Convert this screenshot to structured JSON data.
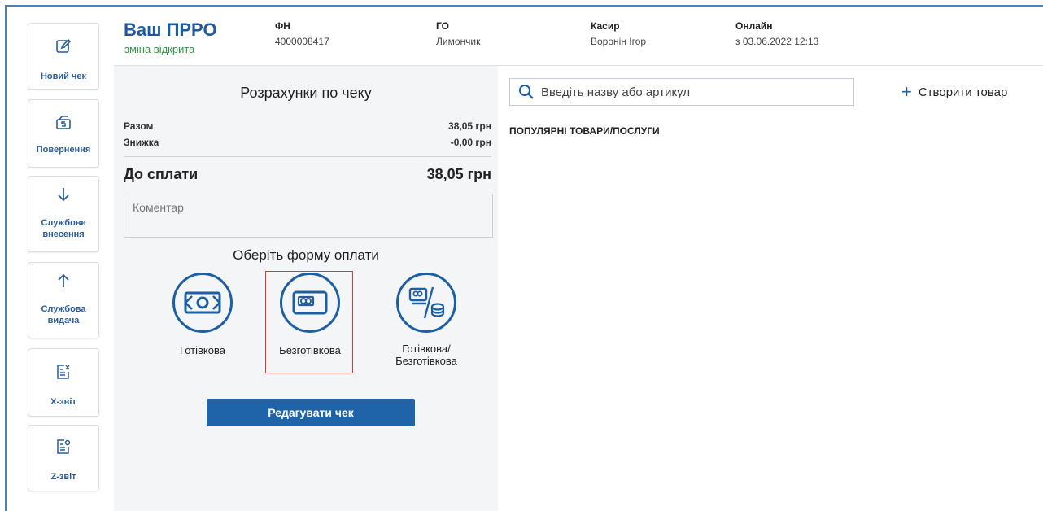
{
  "header": {
    "title": "Ваш ПРРО",
    "status": "зміна відкрита",
    "fn_label": "ФН",
    "fn_value": "4000008417",
    "go_label": "ГО",
    "go_value": "Лимончик",
    "cashier_label": "Касир",
    "cashier_value": "Воронін Ігор",
    "online_label": "Онлайн",
    "online_value": "з 03.06.2022 12:13"
  },
  "sidebar": {
    "items": [
      {
        "label": "Новий чек",
        "icon": "edit-icon"
      },
      {
        "label": "Повернення",
        "icon": "return-icon"
      },
      {
        "label": "Службове внесення",
        "icon": "arrow-down-icon"
      },
      {
        "label": "Службова видача",
        "icon": "arrow-up-icon"
      },
      {
        "label": "Х-звіт",
        "icon": "x-report-icon"
      },
      {
        "label": "Z-звіт",
        "icon": "z-report-icon"
      }
    ]
  },
  "receipt": {
    "title": "Розрахунки по чеку",
    "total_label": "Разом",
    "total_value": "38,05 грн",
    "discount_label": "Знижка",
    "discount_value": "-0,00 грн",
    "pay_label": "До сплати",
    "pay_value": "38,05 грн",
    "comment_placeholder": "Коментар",
    "choose_label": "Оберіть форму оплати",
    "payment_options": [
      {
        "label": "Готівкова",
        "icon": "cash-icon"
      },
      {
        "label": "Безготівкова",
        "icon": "card-icon",
        "selected": true
      },
      {
        "label_line1": "Готівкова/",
        "label_line2": "Безготівкова",
        "icon": "card-coins-icon"
      }
    ],
    "edit_button": "Редагувати чек"
  },
  "products": {
    "search_placeholder": "Введіть назву або артикул",
    "create_label": "Створити товар",
    "popular_title": "ПОПУЛЯРНІ ТОВАРИ/ПОСЛУГИ"
  },
  "colors": {
    "accent": "#1f63a8",
    "title": "#1e5aa0",
    "status_green": "#2f9a46",
    "highlight_red": "#d93a3a"
  }
}
